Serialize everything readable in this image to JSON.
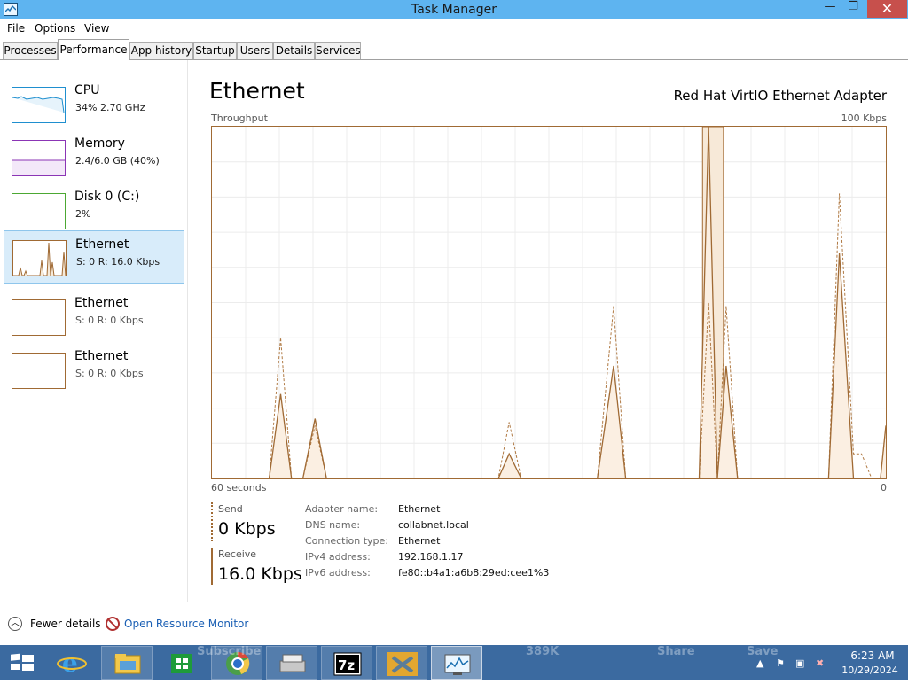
{
  "window": {
    "title": "Task Manager",
    "close_glyph": "✕",
    "minimize_glyph": "—",
    "maximize_glyph": "❐"
  },
  "menu": [
    "File",
    "Options",
    "View"
  ],
  "tabs": [
    "Processes",
    "Performance",
    "App history",
    "Startup",
    "Users",
    "Details",
    "Services"
  ],
  "active_tab": "Performance",
  "resources": [
    {
      "name": "CPU",
      "sub": "34% 2.70 GHz",
      "color": "#1f8fcf",
      "selected": false
    },
    {
      "name": "Memory",
      "sub": "2.4/6.0 GB (40%)",
      "color": "#8b35b5",
      "selected": false
    },
    {
      "name": "Disk 0 (C:)",
      "sub": "2%",
      "color": "#4ca833",
      "selected": false
    },
    {
      "name": "Ethernet",
      "sub_s": "S: 0",
      "sub_r": "R: 16.0 Kbps",
      "color": "#a06a34",
      "selected": true
    },
    {
      "name": "Ethernet",
      "sub_s": "S: 0",
      "sub_r": "R: 0 Kbps",
      "color": "#a06a34",
      "selected": false
    },
    {
      "name": "Ethernet",
      "sub_s": "S: 0",
      "sub_r": "R: 0 Kbps",
      "color": "#a06a34",
      "selected": false
    }
  ],
  "main": {
    "title": "Ethernet",
    "adapter_name": "Red Hat VirtIO Ethernet Adapter",
    "throughput_label": "Throughput",
    "max_label": "100 Kbps",
    "time_left": "60 seconds",
    "time_right": "0"
  },
  "chart_data": {
    "type": "area",
    "title": "Throughput",
    "xlabel": "",
    "ylabel": "",
    "x_range": [
      "60 seconds",
      "0"
    ],
    "ylim": [
      0,
      100
    ],
    "units": "Kbps",
    "grid": true,
    "series": [
      {
        "name": "Receive",
        "style": "solid",
        "points": [
          [
            0,
            0
          ],
          [
            8.5,
            0
          ],
          [
            10.2,
            24
          ],
          [
            11.8,
            0
          ],
          [
            13.5,
            0
          ],
          [
            15.3,
            17
          ],
          [
            17,
            0
          ],
          [
            42.5,
            0
          ],
          [
            44.1,
            7
          ],
          [
            45.9,
            0
          ],
          [
            57.2,
            0
          ],
          [
            59.6,
            32
          ],
          [
            61.4,
            0
          ],
          [
            72.3,
            0
          ],
          [
            73.7,
            100
          ],
          [
            75,
            0
          ],
          [
            76.3,
            32
          ],
          [
            78,
            0
          ],
          [
            91.5,
            0
          ],
          [
            93.1,
            64
          ],
          [
            95.2,
            0
          ],
          [
            96.4,
            0
          ],
          [
            97.9,
            0
          ],
          [
            99.2,
            0
          ],
          [
            100,
            15
          ]
        ]
      },
      {
        "name": "Send",
        "style": "dashed",
        "points": [
          [
            0,
            0
          ],
          [
            8.5,
            0
          ],
          [
            10.2,
            40
          ],
          [
            11.8,
            0
          ],
          [
            13.5,
            0
          ],
          [
            15.3,
            15
          ],
          [
            17,
            0
          ],
          [
            42.5,
            0
          ],
          [
            44.1,
            16
          ],
          [
            45.9,
            0
          ],
          [
            57.2,
            0
          ],
          [
            59.6,
            49
          ],
          [
            61.4,
            0
          ],
          [
            72.3,
            0
          ],
          [
            73.7,
            50
          ],
          [
            75,
            0
          ],
          [
            76.3,
            49
          ],
          [
            78,
            0
          ],
          [
            91.5,
            0
          ],
          [
            93.1,
            81
          ],
          [
            95.2,
            7
          ],
          [
            96.4,
            7
          ],
          [
            97.9,
            0
          ],
          [
            99.2,
            0
          ],
          [
            100,
            15
          ]
        ]
      }
    ],
    "highlight_band": [
      72.8,
      75.9
    ]
  },
  "stats": {
    "send_label": "Send",
    "send_value": "0 Kbps",
    "receive_label": "Receive",
    "receive_value": "16.0 Kbps"
  },
  "properties": [
    {
      "key": "Adapter name:",
      "value": "Ethernet"
    },
    {
      "key": "DNS name:",
      "value": "collabnet.local"
    },
    {
      "key": "Connection type:",
      "value": "Ethernet"
    },
    {
      "key": "IPv4 address:",
      "value": "192.168.1.17"
    },
    {
      "key": "IPv6 address:",
      "value": "fe80::b4a1:a6b8:29ed:cee1%3"
    }
  ],
  "footer": {
    "fewer_details": "Fewer details",
    "open_resource_monitor": "Open Resource Monitor"
  },
  "taskbar": {
    "time": "6:23 AM",
    "date": "10/29/2024",
    "ghost_texts": [
      "389K",
      "Share",
      "Save",
      "Subscribe"
    ],
    "apps": [
      "start",
      "internet-explorer",
      "file-explorer",
      "store",
      "chrome",
      "scanner",
      "7zip",
      "vmware",
      "task-manager"
    ]
  }
}
